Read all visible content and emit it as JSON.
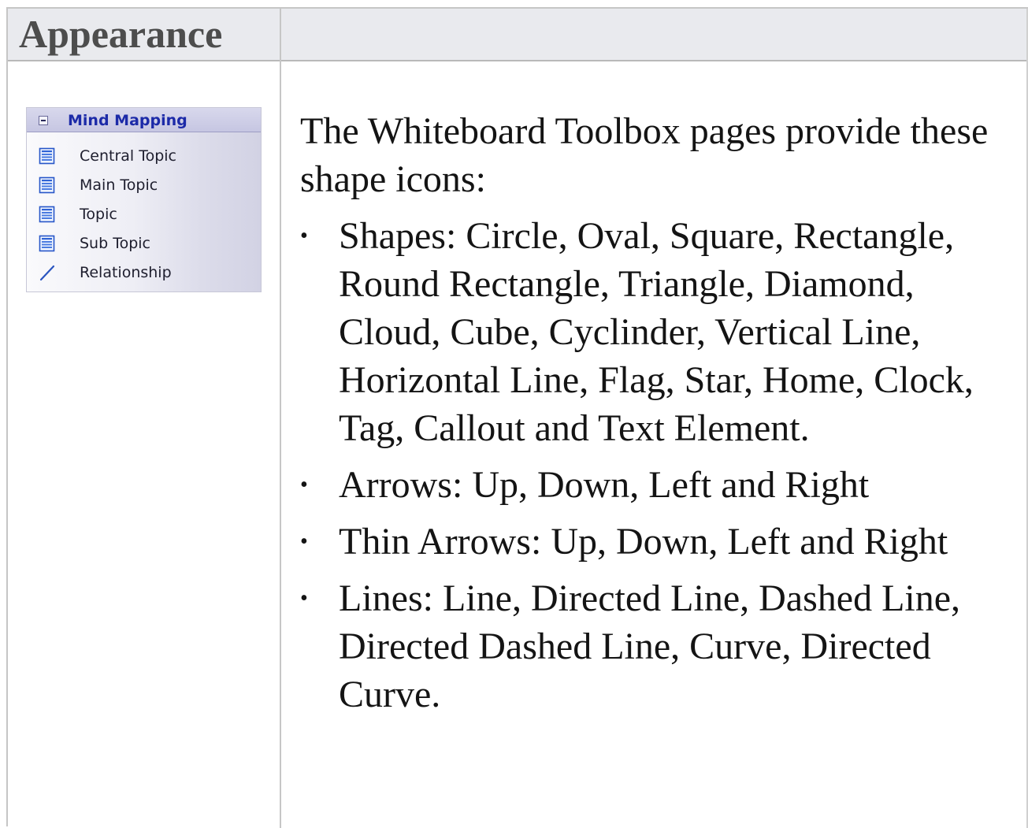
{
  "header": {
    "title": "Appearance"
  },
  "toolbox": {
    "group_title": "Mind Mapping",
    "items": [
      {
        "label": "Central Topic",
        "icon": "topic-element-icon"
      },
      {
        "label": "Main Topic",
        "icon": "topic-element-icon"
      },
      {
        "label": "Topic",
        "icon": "topic-element-icon"
      },
      {
        "label": "Sub Topic",
        "icon": "topic-element-icon"
      },
      {
        "label": "Relationship",
        "icon": "relationship-line-icon"
      }
    ]
  },
  "content": {
    "intro": "The Whiteboard Toolbox pages provide these shape icons:",
    "bullets": [
      "Shapes: Circle, Oval, Square, Rectangle, Round Rectangle, Triangle, Diamond, Cloud, Cube, Cyclinder, Vertical Line, Horizontal Line, Flag, Star, Home, Clock, Tag, Callout and Text Element.",
      "Arrows: Up, Down, Left and Right",
      "Thin Arrows: Up, Down, Left and Right",
      "Lines: Line, Directed Line, Dashed Line, Directed Dashed Line, Curve, Directed Curve."
    ]
  }
}
